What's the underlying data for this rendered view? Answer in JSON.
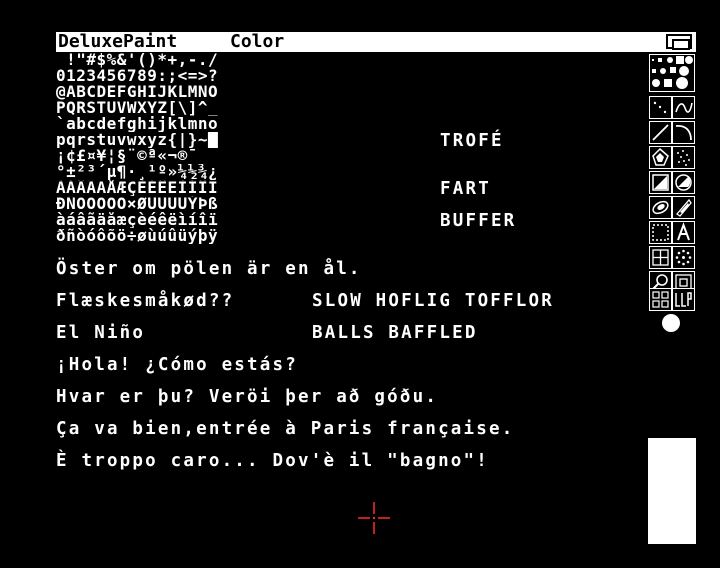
{
  "menubar": {
    "app_title": "DeluxePaint",
    "mode": "Color"
  },
  "charset": [
    " !\"#$%&'()*+,-./",
    "0123456789:;<=>?",
    "@ABCDEFGHIJKLMNO",
    "PQRSTUVWXYZ[\\]^_",
    "`abcdefghijklmno",
    "pqrstuvwxyz{|}~█",
    "¡¢£¤¥¦§¨©ª«¬­®¯",
    "°±²³´µ¶·¸¹º»¼½¾¿",
    "ÀÁÂÃÄÅÆÇÈÉÊËÌÍÎÏ",
    "ÐÑÒÓÔÕÖ×ØÙÚÛÜÝÞß",
    "àáâãäåæçèéêëìíîï",
    "ðñòóôõö÷øùúûüýþÿ"
  ],
  "canvas_text": {
    "trofe": "TROFÉ",
    "fart": "FART",
    "buffer": "BUFFER",
    "line1": "Öster om pölen är en ål.",
    "line2_left": "Flæskesmåkød??",
    "line2_right": "SLOW HOFLIG TOFFLOR",
    "line3_left": "El Niño",
    "line3_right": "BALLS BAFFLED",
    "line4": "¡Hola! ¿Cómo estás?",
    "line5": "Hvar er þu? Veröi þer að góðu.",
    "line6": "Ça va bien,entrée à Paris française.",
    "line7": "È troppo caro... Dov'è il \"bagno\"!"
  },
  "tools": [
    "dotted-freehand-icon",
    "brush-icon",
    "curve-icon",
    "line-icon",
    "filled-freehand-icon",
    "airbrush-icon",
    "filled-rectangle-icon",
    "filled-circle-icon",
    "filled-oval-icon",
    "filled-polygon-icon",
    "brush-pick-icon",
    "text-icon",
    "grid-icon",
    "symmetry-icon",
    "magnify-icon",
    "zoom-icon",
    "undo-icon",
    "clear-icon"
  ],
  "colors": {
    "background": "#000000",
    "foreground": "#ffffff",
    "cursor": "#ff2a2a"
  }
}
